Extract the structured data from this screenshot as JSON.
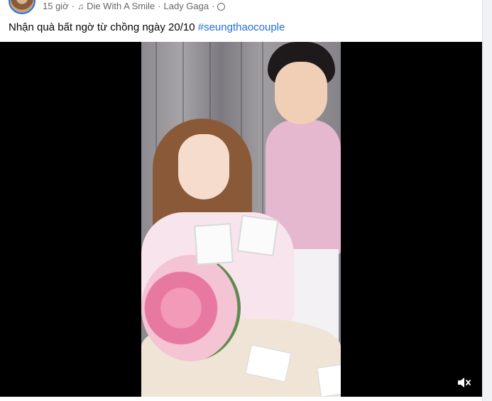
{
  "post": {
    "timestamp": "15 giờ",
    "music_title": "Die With A Smile",
    "music_artist": "Lady Gaga",
    "caption_text": "Nhận quà bất ngờ từ chồng ngày 20/10 ",
    "caption_hashtag": "#seungthaocouple",
    "icons": {
      "avatar": "avatar",
      "music": "music-note-icon",
      "privacy": "globe-icon",
      "mute": "speaker-muted-icon"
    },
    "colors": {
      "hashtag": "#216fdb",
      "meta_text": "#65676b",
      "video_bg": "#000000"
    }
  }
}
